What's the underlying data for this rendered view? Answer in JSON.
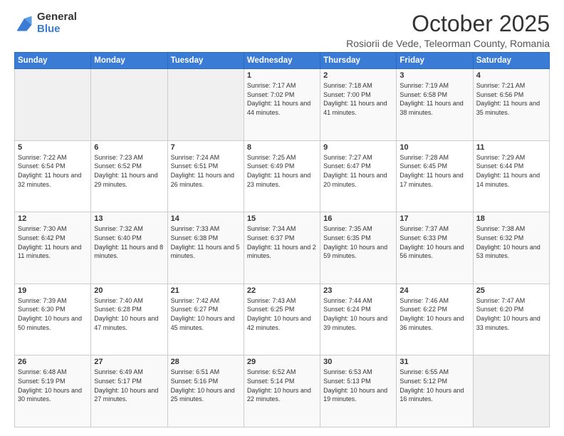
{
  "logo": {
    "general": "General",
    "blue": "Blue"
  },
  "header": {
    "title": "October 2025",
    "subtitle": "Rosiorii de Vede, Teleorman County, Romania"
  },
  "days_of_week": [
    "Sunday",
    "Monday",
    "Tuesday",
    "Wednesday",
    "Thursday",
    "Friday",
    "Saturday"
  ],
  "weeks": [
    [
      {
        "day": "",
        "sunrise": "",
        "sunset": "",
        "daylight": "",
        "empty": true
      },
      {
        "day": "",
        "sunrise": "",
        "sunset": "",
        "daylight": "",
        "empty": true
      },
      {
        "day": "",
        "sunrise": "",
        "sunset": "",
        "daylight": "",
        "empty": true
      },
      {
        "day": "1",
        "sunrise": "Sunrise: 7:17 AM",
        "sunset": "Sunset: 7:02 PM",
        "daylight": "Daylight: 11 hours and 44 minutes."
      },
      {
        "day": "2",
        "sunrise": "Sunrise: 7:18 AM",
        "sunset": "Sunset: 7:00 PM",
        "daylight": "Daylight: 11 hours and 41 minutes."
      },
      {
        "day": "3",
        "sunrise": "Sunrise: 7:19 AM",
        "sunset": "Sunset: 6:58 PM",
        "daylight": "Daylight: 11 hours and 38 minutes."
      },
      {
        "day": "4",
        "sunrise": "Sunrise: 7:21 AM",
        "sunset": "Sunset: 6:56 PM",
        "daylight": "Daylight: 11 hours and 35 minutes."
      }
    ],
    [
      {
        "day": "5",
        "sunrise": "Sunrise: 7:22 AM",
        "sunset": "Sunset: 6:54 PM",
        "daylight": "Daylight: 11 hours and 32 minutes."
      },
      {
        "day": "6",
        "sunrise": "Sunrise: 7:23 AM",
        "sunset": "Sunset: 6:52 PM",
        "daylight": "Daylight: 11 hours and 29 minutes."
      },
      {
        "day": "7",
        "sunrise": "Sunrise: 7:24 AM",
        "sunset": "Sunset: 6:51 PM",
        "daylight": "Daylight: 11 hours and 26 minutes."
      },
      {
        "day": "8",
        "sunrise": "Sunrise: 7:25 AM",
        "sunset": "Sunset: 6:49 PM",
        "daylight": "Daylight: 11 hours and 23 minutes."
      },
      {
        "day": "9",
        "sunrise": "Sunrise: 7:27 AM",
        "sunset": "Sunset: 6:47 PM",
        "daylight": "Daylight: 11 hours and 20 minutes."
      },
      {
        "day": "10",
        "sunrise": "Sunrise: 7:28 AM",
        "sunset": "Sunset: 6:45 PM",
        "daylight": "Daylight: 11 hours and 17 minutes."
      },
      {
        "day": "11",
        "sunrise": "Sunrise: 7:29 AM",
        "sunset": "Sunset: 6:44 PM",
        "daylight": "Daylight: 11 hours and 14 minutes."
      }
    ],
    [
      {
        "day": "12",
        "sunrise": "Sunrise: 7:30 AM",
        "sunset": "Sunset: 6:42 PM",
        "daylight": "Daylight: 11 hours and 11 minutes."
      },
      {
        "day": "13",
        "sunrise": "Sunrise: 7:32 AM",
        "sunset": "Sunset: 6:40 PM",
        "daylight": "Daylight: 11 hours and 8 minutes."
      },
      {
        "day": "14",
        "sunrise": "Sunrise: 7:33 AM",
        "sunset": "Sunset: 6:38 PM",
        "daylight": "Daylight: 11 hours and 5 minutes."
      },
      {
        "day": "15",
        "sunrise": "Sunrise: 7:34 AM",
        "sunset": "Sunset: 6:37 PM",
        "daylight": "Daylight: 11 hours and 2 minutes."
      },
      {
        "day": "16",
        "sunrise": "Sunrise: 7:35 AM",
        "sunset": "Sunset: 6:35 PM",
        "daylight": "Daylight: 10 hours and 59 minutes."
      },
      {
        "day": "17",
        "sunrise": "Sunrise: 7:37 AM",
        "sunset": "Sunset: 6:33 PM",
        "daylight": "Daylight: 10 hours and 56 minutes."
      },
      {
        "day": "18",
        "sunrise": "Sunrise: 7:38 AM",
        "sunset": "Sunset: 6:32 PM",
        "daylight": "Daylight: 10 hours and 53 minutes."
      }
    ],
    [
      {
        "day": "19",
        "sunrise": "Sunrise: 7:39 AM",
        "sunset": "Sunset: 6:30 PM",
        "daylight": "Daylight: 10 hours and 50 minutes."
      },
      {
        "day": "20",
        "sunrise": "Sunrise: 7:40 AM",
        "sunset": "Sunset: 6:28 PM",
        "daylight": "Daylight: 10 hours and 47 minutes."
      },
      {
        "day": "21",
        "sunrise": "Sunrise: 7:42 AM",
        "sunset": "Sunset: 6:27 PM",
        "daylight": "Daylight: 10 hours and 45 minutes."
      },
      {
        "day": "22",
        "sunrise": "Sunrise: 7:43 AM",
        "sunset": "Sunset: 6:25 PM",
        "daylight": "Daylight: 10 hours and 42 minutes."
      },
      {
        "day": "23",
        "sunrise": "Sunrise: 7:44 AM",
        "sunset": "Sunset: 6:24 PM",
        "daylight": "Daylight: 10 hours and 39 minutes."
      },
      {
        "day": "24",
        "sunrise": "Sunrise: 7:46 AM",
        "sunset": "Sunset: 6:22 PM",
        "daylight": "Daylight: 10 hours and 36 minutes."
      },
      {
        "day": "25",
        "sunrise": "Sunrise: 7:47 AM",
        "sunset": "Sunset: 6:20 PM",
        "daylight": "Daylight: 10 hours and 33 minutes."
      }
    ],
    [
      {
        "day": "26",
        "sunrise": "Sunrise: 6:48 AM",
        "sunset": "Sunset: 5:19 PM",
        "daylight": "Daylight: 10 hours and 30 minutes."
      },
      {
        "day": "27",
        "sunrise": "Sunrise: 6:49 AM",
        "sunset": "Sunset: 5:17 PM",
        "daylight": "Daylight: 10 hours and 27 minutes."
      },
      {
        "day": "28",
        "sunrise": "Sunrise: 6:51 AM",
        "sunset": "Sunset: 5:16 PM",
        "daylight": "Daylight: 10 hours and 25 minutes."
      },
      {
        "day": "29",
        "sunrise": "Sunrise: 6:52 AM",
        "sunset": "Sunset: 5:14 PM",
        "daylight": "Daylight: 10 hours and 22 minutes."
      },
      {
        "day": "30",
        "sunrise": "Sunrise: 6:53 AM",
        "sunset": "Sunset: 5:13 PM",
        "daylight": "Daylight: 10 hours and 19 minutes."
      },
      {
        "day": "31",
        "sunrise": "Sunrise: 6:55 AM",
        "sunset": "Sunset: 5:12 PM",
        "daylight": "Daylight: 10 hours and 16 minutes."
      },
      {
        "day": "",
        "sunrise": "",
        "sunset": "",
        "daylight": "",
        "empty": true
      }
    ]
  ]
}
